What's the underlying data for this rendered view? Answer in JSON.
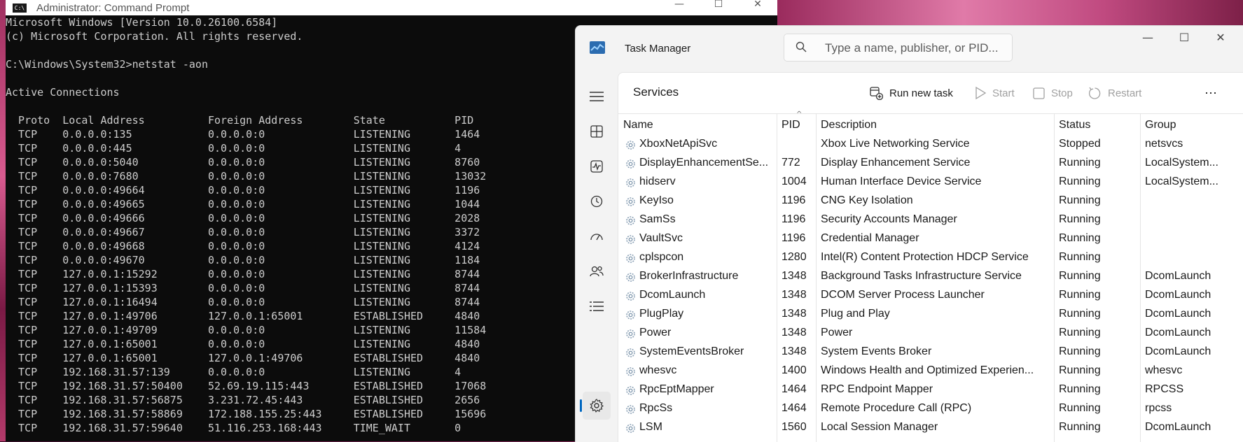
{
  "cmd": {
    "title": "Administrator: Command Prompt",
    "icon_label": "C:\\",
    "lines": [
      "Microsoft Windows [Version 10.0.26100.6584]",
      "(c) Microsoft Corporation. All rights reserved.",
      "",
      "C:\\Windows\\System32>netstat -aon",
      "",
      "Active Connections",
      "",
      "  Proto  Local Address          Foreign Address        State           PID",
      "  TCP    0.0.0.0:135            0.0.0.0:0              LISTENING       1464",
      "  TCP    0.0.0.0:445            0.0.0.0:0              LISTENING       4",
      "  TCP    0.0.0.0:5040           0.0.0.0:0              LISTENING       8760",
      "  TCP    0.0.0.0:7680           0.0.0.0:0              LISTENING       13032",
      "  TCP    0.0.0.0:49664          0.0.0.0:0              LISTENING       1196",
      "  TCP    0.0.0.0:49665          0.0.0.0:0              LISTENING       1044",
      "  TCP    0.0.0.0:49666          0.0.0.0:0              LISTENING       2028",
      "  TCP    0.0.0.0:49667          0.0.0.0:0              LISTENING       3372",
      "  TCP    0.0.0.0:49668          0.0.0.0:0              LISTENING       4124",
      "  TCP    0.0.0.0:49670          0.0.0.0:0              LISTENING       1184",
      "  TCP    127.0.0.1:15292        0.0.0.0:0              LISTENING       8744",
      "  TCP    127.0.0.1:15393        0.0.0.0:0              LISTENING       8744",
      "  TCP    127.0.0.1:16494        0.0.0.0:0              LISTENING       8744",
      "  TCP    127.0.0.1:49706        127.0.0.1:65001        ESTABLISHED     4840",
      "  TCP    127.0.0.1:49709        0.0.0.0:0              LISTENING       11584",
      "  TCP    127.0.0.1:65001        0.0.0.0:0              LISTENING       4840",
      "  TCP    127.0.0.1:65001        127.0.0.1:49706        ESTABLISHED     4840",
      "  TCP    192.168.31.57:139      0.0.0.0:0              LISTENING       4",
      "  TCP    192.168.31.57:50400    52.69.19.115:443       ESTABLISHED     17068",
      "  TCP    192.168.31.57:56875    3.231.72.45:443        ESTABLISHED     2656",
      "  TCP    192.168.31.57:58869    172.188.155.25:443     ESTABLISHED     15696",
      "  TCP    192.168.31.57:59640    51.116.253.168:443     TIME_WAIT       0"
    ]
  },
  "taskmanager": {
    "title": "Task Manager",
    "search_placeholder": "Type a name, publisher, or PID...",
    "page_heading": "Services",
    "toolbar": {
      "run_new_task": "Run new task",
      "start": "Start",
      "stop": "Stop",
      "restart": "Restart",
      "more": "⋯"
    },
    "columns": {
      "name": "Name",
      "pid": "PID",
      "description": "Description",
      "status": "Status",
      "group": "Group"
    },
    "services": [
      {
        "name": "XboxNetApiSvc",
        "pid": "",
        "description": "Xbox Live Networking Service",
        "status": "Stopped",
        "group": "netsvcs"
      },
      {
        "name": "DisplayEnhancementSe...",
        "pid": "772",
        "description": "Display Enhancement Service",
        "status": "Running",
        "group": "LocalSystem..."
      },
      {
        "name": "hidserv",
        "pid": "1004",
        "description": "Human Interface Device Service",
        "status": "Running",
        "group": "LocalSystem..."
      },
      {
        "name": "KeyIso",
        "pid": "1196",
        "description": "CNG Key Isolation",
        "status": "Running",
        "group": ""
      },
      {
        "name": "SamSs",
        "pid": "1196",
        "description": "Security Accounts Manager",
        "status": "Running",
        "group": ""
      },
      {
        "name": "VaultSvc",
        "pid": "1196",
        "description": "Credential Manager",
        "status": "Running",
        "group": ""
      },
      {
        "name": "cplspcon",
        "pid": "1280",
        "description": "Intel(R) Content Protection HDCP Service",
        "status": "Running",
        "group": ""
      },
      {
        "name": "BrokerInfrastructure",
        "pid": "1348",
        "description": "Background Tasks Infrastructure Service",
        "status": "Running",
        "group": "DcomLaunch"
      },
      {
        "name": "DcomLaunch",
        "pid": "1348",
        "description": "DCOM Server Process Launcher",
        "status": "Running",
        "group": "DcomLaunch"
      },
      {
        "name": "PlugPlay",
        "pid": "1348",
        "description": "Plug and Play",
        "status": "Running",
        "group": "DcomLaunch"
      },
      {
        "name": "Power",
        "pid": "1348",
        "description": "Power",
        "status": "Running",
        "group": "DcomLaunch"
      },
      {
        "name": "SystemEventsBroker",
        "pid": "1348",
        "description": "System Events Broker",
        "status": "Running",
        "group": "DcomLaunch"
      },
      {
        "name": "whesvc",
        "pid": "1400",
        "description": "Windows Health and Optimized Experien...",
        "status": "Running",
        "group": "whesvc"
      },
      {
        "name": "RpcEptMapper",
        "pid": "1464",
        "description": "RPC Endpoint Mapper",
        "status": "Running",
        "group": "RPCSS"
      },
      {
        "name": "RpcSs",
        "pid": "1464",
        "description": "Remote Procedure Call (RPC)",
        "status": "Running",
        "group": "rpcss"
      },
      {
        "name": "LSM",
        "pid": "1560",
        "description": "Local Session Manager",
        "status": "Running",
        "group": "DcomLaunch"
      }
    ],
    "nav_icons": [
      "hamburger-icon",
      "processes-icon",
      "performance-icon",
      "app-history-icon",
      "startup-apps-icon",
      "users-icon",
      "details-icon",
      "services-icon"
    ]
  }
}
